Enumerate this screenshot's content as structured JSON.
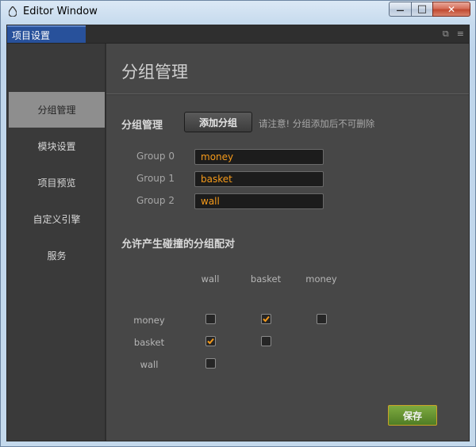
{
  "window": {
    "title": "Editor Window",
    "minimize_glyph": "—",
    "maximize_glyph": "□",
    "close_glyph": "✕"
  },
  "tab": {
    "label": "项目设置",
    "icons": [
      "restore-icon",
      "menu-icon"
    ],
    "restore_glyph": "⧉",
    "menu_glyph": "≡"
  },
  "sidebar": {
    "items": [
      {
        "label": "分组管理",
        "active": true
      },
      {
        "label": "模块设置",
        "active": false
      },
      {
        "label": "项目预览",
        "active": false
      },
      {
        "label": "自定义引擎",
        "active": false
      },
      {
        "label": "服务",
        "active": false
      }
    ]
  },
  "main": {
    "title": "分组管理",
    "group_section": {
      "label": "分组管理",
      "add_button": "添加分组",
      "note": "请注意! 分组添加后不可删除",
      "groups": [
        {
          "label": "Group 0",
          "value": "money"
        },
        {
          "label": "Group 1",
          "value": "basket"
        },
        {
          "label": "Group 2",
          "value": "wall"
        }
      ]
    },
    "collision_section": {
      "label": "允许产生碰撞的分组配对",
      "columns": [
        "wall",
        "basket",
        "money"
      ],
      "rows": [
        {
          "label": "money",
          "checks": [
            false,
            true,
            false
          ]
        },
        {
          "label": "basket",
          "checks": [
            true,
            false
          ]
        },
        {
          "label": "wall",
          "checks": [
            false
          ]
        }
      ]
    },
    "save_button": "保存"
  },
  "colors": {
    "accent_orange": "#f59a1a",
    "tab_blue": "#28519b",
    "save_green": "#5f8f2e",
    "panel_bg": "#474747"
  }
}
